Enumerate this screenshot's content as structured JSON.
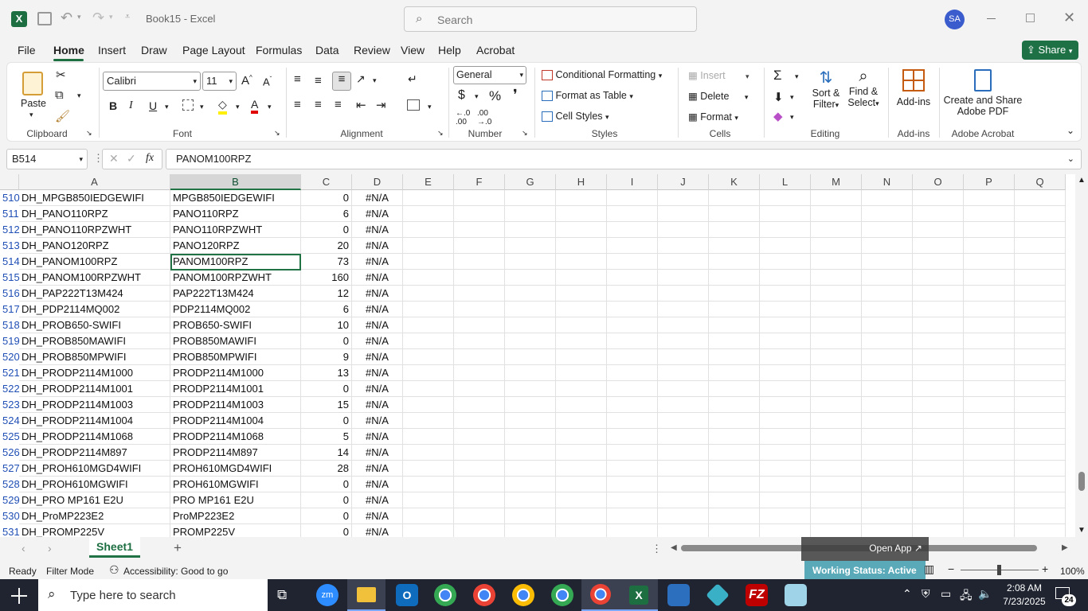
{
  "titlebar": {
    "doc_title": "Book15 - Excel",
    "search_placeholder": "Search",
    "avatar_initials": "SA"
  },
  "menu": {
    "tabs": [
      "File",
      "Home",
      "Insert",
      "Draw",
      "Page Layout",
      "Formulas",
      "Data",
      "Review",
      "View",
      "Help",
      "Acrobat"
    ],
    "share_label": "Share"
  },
  "ribbon": {
    "clipboard": {
      "paste": "Paste",
      "label": "Clipboard"
    },
    "font": {
      "name": "Calibri",
      "size": "11",
      "label": "Font"
    },
    "alignment": {
      "label": "Alignment"
    },
    "number": {
      "format": "General",
      "label": "Number"
    },
    "styles": {
      "conditional": "Conditional Formatting",
      "format_table": "Format as Table",
      "cell_styles": "Cell Styles",
      "label": "Styles"
    },
    "cells": {
      "insert": "Insert",
      "delete": "Delete",
      "format": "Format",
      "label": "Cells"
    },
    "editing": {
      "sort1": "Sort &",
      "sort2": "Filter",
      "find1": "Find &",
      "find2": "Select",
      "label": "Editing"
    },
    "addins": {
      "addins": "Add-ins",
      "label": "Add-ins"
    },
    "acrobat": {
      "create1": "Create and Share",
      "create2": "Adobe PDF",
      "label": "Adobe Acrobat"
    }
  },
  "formula": {
    "name_box": "B514",
    "fx": "fx",
    "value": "PANOM100RPZ"
  },
  "columns": [
    "A",
    "B",
    "C",
    "D",
    "E",
    "F",
    "G",
    "H",
    "I",
    "J",
    "K",
    "L",
    "M",
    "N",
    "O",
    "P",
    "Q"
  ],
  "rows": [
    {
      "n": "510",
      "a": "DH_MPGB850IEDGEWIFI",
      "b": "MPGB850IEDGEWIFI",
      "c": "0",
      "d": "#N/A"
    },
    {
      "n": "511",
      "a": "DH_PANO110RPZ",
      "b": "PANO110RPZ",
      "c": "6",
      "d": "#N/A"
    },
    {
      "n": "512",
      "a": "DH_PANO110RPZWHT",
      "b": "PANO110RPZWHT",
      "c": "0",
      "d": "#N/A"
    },
    {
      "n": "513",
      "a": "DH_PANO120RPZ",
      "b": "PANO120RPZ",
      "c": "20",
      "d": "#N/A"
    },
    {
      "n": "514",
      "a": "DH_PANOM100RPZ",
      "b": "PANOM100RPZ",
      "c": "73",
      "d": "#N/A"
    },
    {
      "n": "515",
      "a": "DH_PANOM100RPZWHT",
      "b": "PANOM100RPZWHT",
      "c": "160",
      "d": "#N/A"
    },
    {
      "n": "516",
      "a": "DH_PAP222T13M424",
      "b": "PAP222T13M424",
      "c": "12",
      "d": "#N/A"
    },
    {
      "n": "517",
      "a": "DH_PDP2114MQ002",
      "b": "PDP2114MQ002",
      "c": "6",
      "d": "#N/A"
    },
    {
      "n": "518",
      "a": "DH_PROB650-SWIFI",
      "b": "PROB650-SWIFI",
      "c": "10",
      "d": "#N/A"
    },
    {
      "n": "519",
      "a": "DH_PROB850MAWIFI",
      "b": "PROB850MAWIFI",
      "c": "0",
      "d": "#N/A"
    },
    {
      "n": "520",
      "a": "DH_PROB850MPWIFI",
      "b": "PROB850MPWIFI",
      "c": "9",
      "d": "#N/A"
    },
    {
      "n": "521",
      "a": "DH_PRODP2114M1000",
      "b": "PRODP2114M1000",
      "c": "13",
      "d": "#N/A"
    },
    {
      "n": "522",
      "a": "DH_PRODP2114M1001",
      "b": "PRODP2114M1001",
      "c": "0",
      "d": "#N/A"
    },
    {
      "n": "523",
      "a": "DH_PRODP2114M1003",
      "b": "PRODP2114M1003",
      "c": "15",
      "d": "#N/A"
    },
    {
      "n": "524",
      "a": "DH_PRODP2114M1004",
      "b": "PRODP2114M1004",
      "c": "0",
      "d": "#N/A"
    },
    {
      "n": "525",
      "a": "DH_PRODP2114M1068",
      "b": "PRODP2114M1068",
      "c": "5",
      "d": "#N/A"
    },
    {
      "n": "526",
      "a": "DH_PRODP2114M897",
      "b": "PRODP2114M897",
      "c": "14",
      "d": "#N/A"
    },
    {
      "n": "527",
      "a": "DH_PROH610MGD4WIFI",
      "b": "PROH610MGD4WIFI",
      "c": "28",
      "d": "#N/A"
    },
    {
      "n": "528",
      "a": "DH_PROH610MGWIFI",
      "b": "PROH610MGWIFI",
      "c": "0",
      "d": "#N/A"
    },
    {
      "n": "529",
      "a": "DH_PRO MP161 E2U",
      "b": "PRO MP161 E2U",
      "c": "0",
      "d": "#N/A"
    },
    {
      "n": "530",
      "a": "DH_ProMP223E2",
      "b": "ProMP223E2",
      "c": "0",
      "d": "#N/A"
    },
    {
      "n": "531",
      "a": "DH_PROMP225V",
      "b": "PROMP225V",
      "c": "0",
      "d": "#N/A"
    }
  ],
  "sheet": {
    "tab": "Sheet1",
    "open_app": "Open App ↗"
  },
  "status": {
    "ready": "Ready",
    "filter": "Filter Mode",
    "accessibility": "Accessibility: Good to go",
    "working": "Working Status: Active",
    "zoom": "100%"
  },
  "taskbar": {
    "search_placeholder": "Type here to search",
    "time": "2:08 AM",
    "date": "7/23/2025",
    "notif": "24"
  },
  "colors": {
    "excel_green": "#217346",
    "share_green": "#1e7145"
  }
}
